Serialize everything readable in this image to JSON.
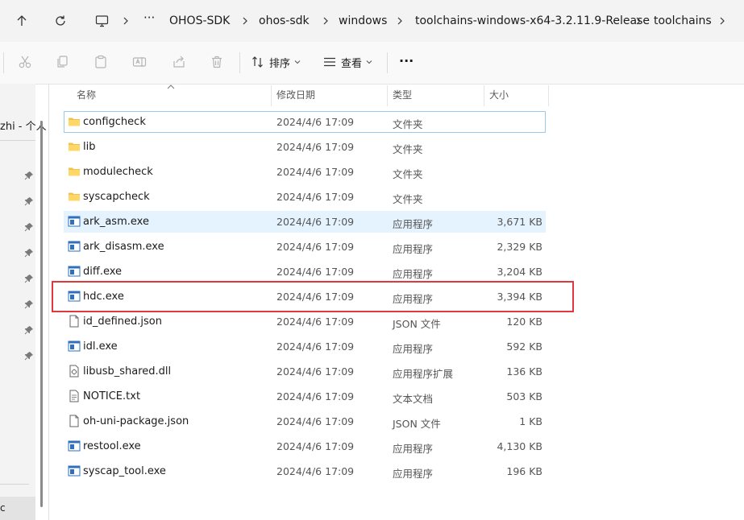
{
  "address_bar": {
    "crumbs": [
      "OHOS-SDK",
      "ohos-sdk",
      "windows",
      "toolchains-windows-x64-3.2.11.9-Release",
      "toolchains"
    ],
    "overflow_label": "···"
  },
  "toolbar": {
    "sort_label": "排序",
    "view_label": "查看",
    "more_label": "···"
  },
  "nav": {
    "quick_access_title": "zhi - 个人",
    "bottom_item": "c"
  },
  "columns": {
    "name": "名称",
    "modified": "修改日期",
    "type": "类型",
    "size": "大小"
  },
  "files": [
    {
      "name": "configcheck",
      "modified": "2024/4/6 17:09",
      "type": "文件夹",
      "size": "",
      "icon": "folder-icon"
    },
    {
      "name": "lib",
      "modified": "2024/4/6 17:09",
      "type": "文件夹",
      "size": "",
      "icon": "folder-icon"
    },
    {
      "name": "modulecheck",
      "modified": "2024/4/6 17:09",
      "type": "文件夹",
      "size": "",
      "icon": "folder-icon"
    },
    {
      "name": "syscapcheck",
      "modified": "2024/4/6 17:09",
      "type": "文件夹",
      "size": "",
      "icon": "folder-icon"
    },
    {
      "name": "ark_asm.exe",
      "modified": "2024/4/6 17:09",
      "type": "应用程序",
      "size": "3,671 KB",
      "icon": "exe-icon"
    },
    {
      "name": "ark_disasm.exe",
      "modified": "2024/4/6 17:09",
      "type": "应用程序",
      "size": "2,329 KB",
      "icon": "exe-icon"
    },
    {
      "name": "diff.exe",
      "modified": "2024/4/6 17:09",
      "type": "应用程序",
      "size": "3,204 KB",
      "icon": "exe-icon"
    },
    {
      "name": "hdc.exe",
      "modified": "2024/4/6 17:09",
      "type": "应用程序",
      "size": "3,394 KB",
      "icon": "exe-icon"
    },
    {
      "name": "id_defined.json",
      "modified": "2024/4/6 17:09",
      "type": "JSON 文件",
      "size": "120 KB",
      "icon": "document-icon"
    },
    {
      "name": "idl.exe",
      "modified": "2024/4/6 17:09",
      "type": "应用程序",
      "size": "592 KB",
      "icon": "exe-icon"
    },
    {
      "name": "libusb_shared.dll",
      "modified": "2024/4/6 17:09",
      "type": "应用程序扩展",
      "size": "136 KB",
      "icon": "dll-icon"
    },
    {
      "name": "NOTICE.txt",
      "modified": "2024/4/6 17:09",
      "type": "文本文档",
      "size": "503 KB",
      "icon": "text-file-icon"
    },
    {
      "name": "oh-uni-package.json",
      "modified": "2024/4/6 17:09",
      "type": "JSON 文件",
      "size": "1 KB",
      "icon": "document-icon"
    },
    {
      "name": "restool.exe",
      "modified": "2024/4/6 17:09",
      "type": "应用程序",
      "size": "4,130 KB",
      "icon": "exe-icon"
    },
    {
      "name": "syscap_tool.exe",
      "modified": "2024/4/6 17:09",
      "type": "应用程序",
      "size": "196 KB",
      "icon": "exe-icon"
    }
  ],
  "colors": {
    "selection": "#e5f3ff",
    "highlight_box": "#e0393c",
    "folder": "#f3c14b",
    "exe_accent": "#2f6fbd"
  }
}
